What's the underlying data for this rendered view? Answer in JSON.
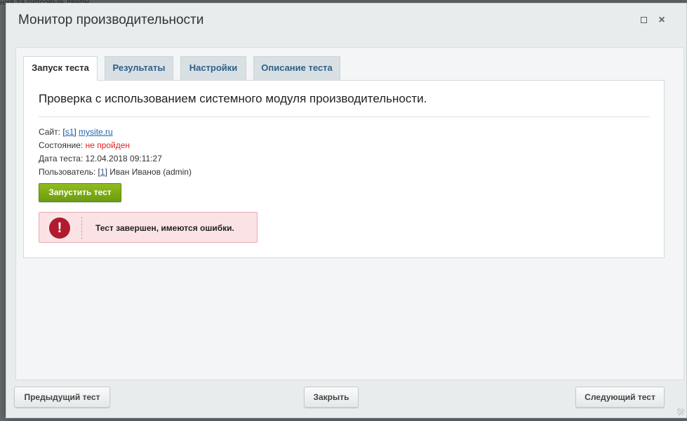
{
  "dialog": {
    "title": "Монитор производительности"
  },
  "backdrop_text": "ния за гипсовые дверн",
  "tabs": [
    {
      "label": "Запуск теста",
      "active": true
    },
    {
      "label": "Результаты",
      "active": false
    },
    {
      "label": "Настройки",
      "active": false
    },
    {
      "label": "Описание теста",
      "active": false
    }
  ],
  "panel": {
    "heading": "Проверка с использованием системного модуля производительности.",
    "site_label": "Сайт:",
    "site_code": "s1",
    "site_domain": "mysite.ru",
    "status_label": "Состояние:",
    "status_value": "не пройден",
    "date_label": "Дата теста:",
    "date_value": "12.04.2018 09:11:27",
    "user_label": "Пользователь:",
    "user_id": "1",
    "user_name": "Иван Иванов (admin)",
    "run_button": "Запустить тест",
    "alert_icon": "!",
    "alert_text": "Тест завершен, имеются ошибки."
  },
  "footer": {
    "prev_button": "Предыдущий тест",
    "close_button": "Закрыть",
    "next_button": "Следующий тест"
  },
  "colors": {
    "accent_green": "#7bab15",
    "error_red": "#e62020",
    "alert_bg": "#fbe3e5",
    "link_blue": "#2067b0"
  },
  "icons": {
    "maximize": "maximize-icon",
    "close": "close-icon",
    "alert": "exclamation-icon"
  }
}
